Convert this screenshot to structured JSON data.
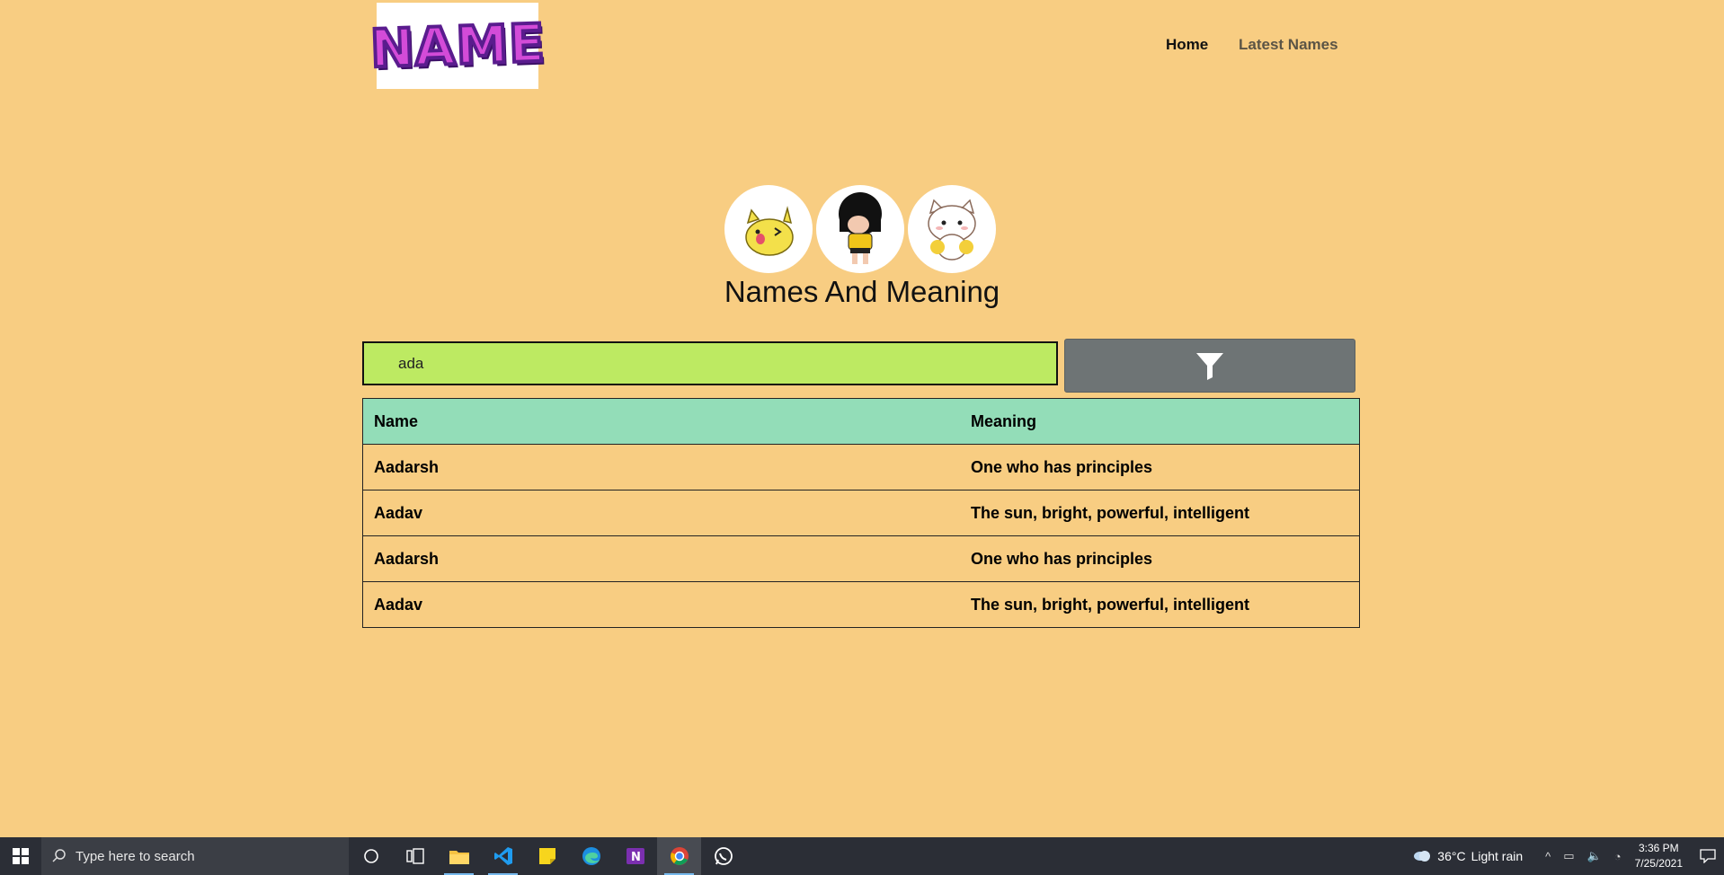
{
  "header": {
    "logo_text": "NAME",
    "nav": [
      {
        "label": "Home"
      },
      {
        "label": "Latest Names"
      }
    ]
  },
  "hero": {
    "title": "Names And Meaning",
    "avatars": [
      "yellow-cat-sticker",
      "girl-sticker",
      "white-cat-sticker"
    ]
  },
  "search": {
    "value": "ada",
    "filter_icon": "filter-icon"
  },
  "table": {
    "headers": [
      "Name",
      "Meaning"
    ],
    "rows": [
      {
        "name": "Aadarsh",
        "meaning": "One who has principles"
      },
      {
        "name": "Aadav",
        "meaning": "The sun, bright, powerful, intelligent"
      },
      {
        "name": "Aadarsh",
        "meaning": "One who has principles"
      },
      {
        "name": "Aadav",
        "meaning": "The sun, bright, powerful, intelligent"
      }
    ]
  },
  "taskbar": {
    "search_placeholder": "Type here to search",
    "weather_temp": "36°C",
    "weather_text": "Light rain",
    "time": "3:36 PM",
    "date": "7/25/2021"
  },
  "colors": {
    "page_bg": "#f8cd82",
    "search_bg": "#bdea62",
    "table_header_bg": "#93ddb8",
    "filter_btn_bg": "#6e7475"
  }
}
